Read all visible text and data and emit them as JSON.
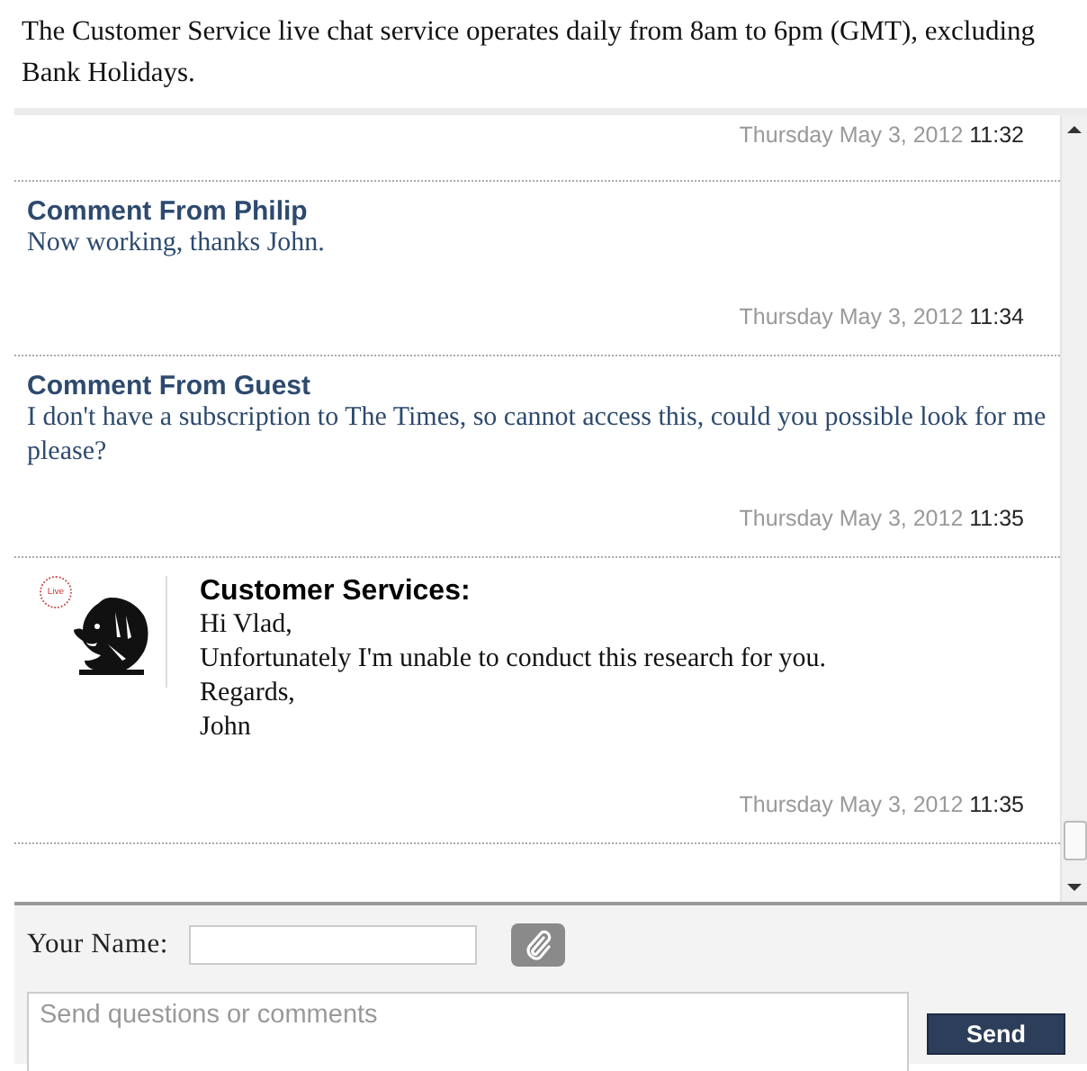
{
  "notice": "The Customer Service live chat service operates daily from 8am to 6pm (GMT), excluding Bank Holidays.",
  "messages": [
    {
      "kind": "cut",
      "date": "Thursday May 3, 2012",
      "time": "11:32"
    },
    {
      "kind": "comment",
      "heading": "Comment From Philip",
      "lines": [
        "Now working, thanks John."
      ],
      "date": "Thursday May 3, 2012",
      "time": "11:34"
    },
    {
      "kind": "comment",
      "heading": "Comment From Guest",
      "lines": [
        "I don't have a subscription to The Times, so cannot access this, could you possible look for me please?"
      ],
      "date": "Thursday May 3, 2012",
      "time": "11:35"
    },
    {
      "kind": "agent",
      "badge": "Live",
      "heading": "Customer Services:",
      "lines": [
        "Hi Vlad,",
        "Unfortunately I'm unable to conduct this research for you.",
        "Regards,",
        "John"
      ],
      "date": "Thursday May 3, 2012",
      "time": "11:35"
    }
  ],
  "form": {
    "name_label": "Your Name:",
    "message_placeholder": "Send questions or comments",
    "send_label": "Send"
  }
}
